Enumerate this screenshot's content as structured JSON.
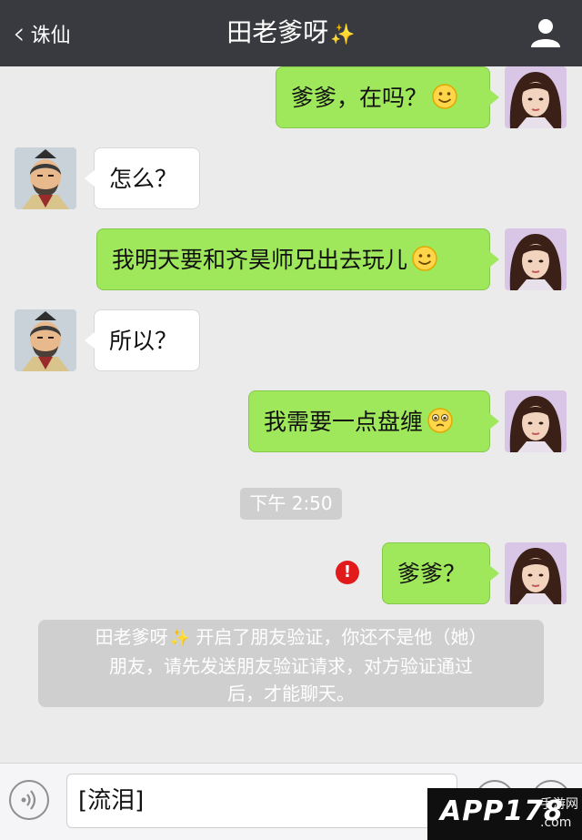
{
  "navbar": {
    "back_label": "诛仙",
    "title": "田老爹呀",
    "title_emoji": "✨"
  },
  "messages": [
    {
      "from": "me",
      "text": "爹爹，在吗？",
      "emoji": "smile"
    },
    {
      "from": "dad",
      "text": "怎么？"
    },
    {
      "from": "me",
      "text": "我明天要和齐昊师兄出去玩儿",
      "emoji": "smile"
    },
    {
      "from": "dad",
      "text": "所以？"
    },
    {
      "from": "me",
      "text": "我需要一点盘缠",
      "emoji": "pleading"
    },
    {
      "timestamp": "下午 2:50"
    },
    {
      "from": "me",
      "text": "爹爹？",
      "status": "failed",
      "status_icon": "!"
    }
  ],
  "system_notice": {
    "line1_name": "田老爹呀",
    "line1_rest": "开启了朋友验证，你还不是他（她）",
    "line2": "朋友，请先发送朋友验证请求，对方验证通过",
    "line3": "后，才能聊天。"
  },
  "input_bar": {
    "value": "[流泪]"
  },
  "watermark": {
    "main": "APP178",
    "sub1": "手游网",
    "sub2": ".com"
  },
  "colors": {
    "navbar": "#393a3f",
    "outgoing_bubble": "#9fe85c",
    "incoming_bubble": "#ffffff",
    "background": "#ebebeb",
    "error": "#e11b1b"
  }
}
